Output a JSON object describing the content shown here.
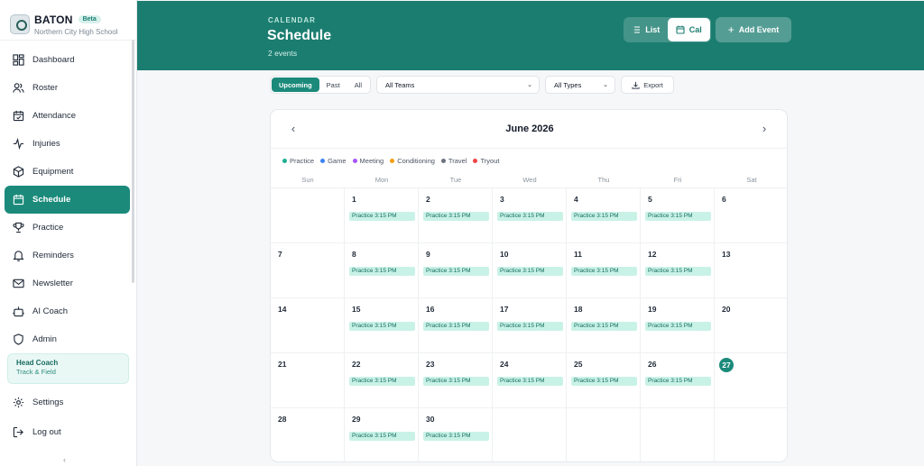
{
  "app": {
    "name": "BATON",
    "badge": "Beta",
    "school": "Northern City High School"
  },
  "sidebar": {
    "items": [
      {
        "label": "Dashboard",
        "icon": "grid-icon"
      },
      {
        "label": "Roster",
        "icon": "users-icon"
      },
      {
        "label": "Attendance",
        "icon": "calendar-check-icon"
      },
      {
        "label": "Injuries",
        "icon": "activity-icon"
      },
      {
        "label": "Equipment",
        "icon": "box-icon"
      },
      {
        "label": "Schedule",
        "icon": "calendar-icon",
        "active": true
      },
      {
        "label": "Practice",
        "icon": "trophy-icon"
      },
      {
        "label": "Reminders",
        "icon": "bell-icon"
      },
      {
        "label": "Newsletter",
        "icon": "mail-icon"
      },
      {
        "label": "AI Coach",
        "icon": "bot-icon"
      },
      {
        "label": "Admin",
        "icon": "shield-icon"
      }
    ],
    "role": {
      "title": "Head Coach",
      "team": "Track & Field"
    },
    "bottom": [
      {
        "label": "Settings",
        "icon": "gear-icon"
      },
      {
        "label": "Log out",
        "icon": "logout-icon"
      }
    ],
    "collapse_glyph": "‹"
  },
  "header": {
    "eyebrow": "CALENDAR",
    "title": "Schedule",
    "subtitle": "2 events",
    "view_list": "List",
    "view_cal": "Cal",
    "add_event": "Add Event"
  },
  "filters": {
    "range": [
      "Upcoming",
      "Past",
      "All"
    ],
    "range_selected": "Upcoming",
    "team": "All Teams",
    "type": "All Types",
    "export": "Export"
  },
  "calendar": {
    "month": "June 2026",
    "prev_glyph": "‹",
    "next_glyph": "›",
    "legend": [
      {
        "label": "Practice",
        "color": "#1fae93"
      },
      {
        "label": "Game",
        "color": "#3b82f6"
      },
      {
        "label": "Meeting",
        "color": "#a855f7"
      },
      {
        "label": "Conditioning",
        "color": "#f59e0b"
      },
      {
        "label": "Travel",
        "color": "#6b7280"
      },
      {
        "label": "Tryout",
        "color": "#ef4444"
      }
    ],
    "weekdays": [
      "Sun",
      "Mon",
      "Tue",
      "Wed",
      "Thu",
      "Fri",
      "Sat"
    ],
    "today": 27,
    "event_label": "Practice 3:15 PM",
    "weeks": [
      [
        null,
        1,
        2,
        3,
        4,
        5,
        6
      ],
      [
        7,
        8,
        9,
        10,
        11,
        12,
        13
      ],
      [
        14,
        15,
        16,
        17,
        18,
        19,
        20
      ],
      [
        21,
        22,
        23,
        24,
        25,
        26,
        27
      ],
      [
        28,
        29,
        30,
        null,
        null,
        null,
        null
      ]
    ],
    "event_days": [
      1,
      2,
      3,
      4,
      5,
      8,
      9,
      10,
      11,
      12,
      15,
      16,
      17,
      18,
      19,
      22,
      23,
      24,
      25,
      26,
      29,
      30
    ]
  }
}
